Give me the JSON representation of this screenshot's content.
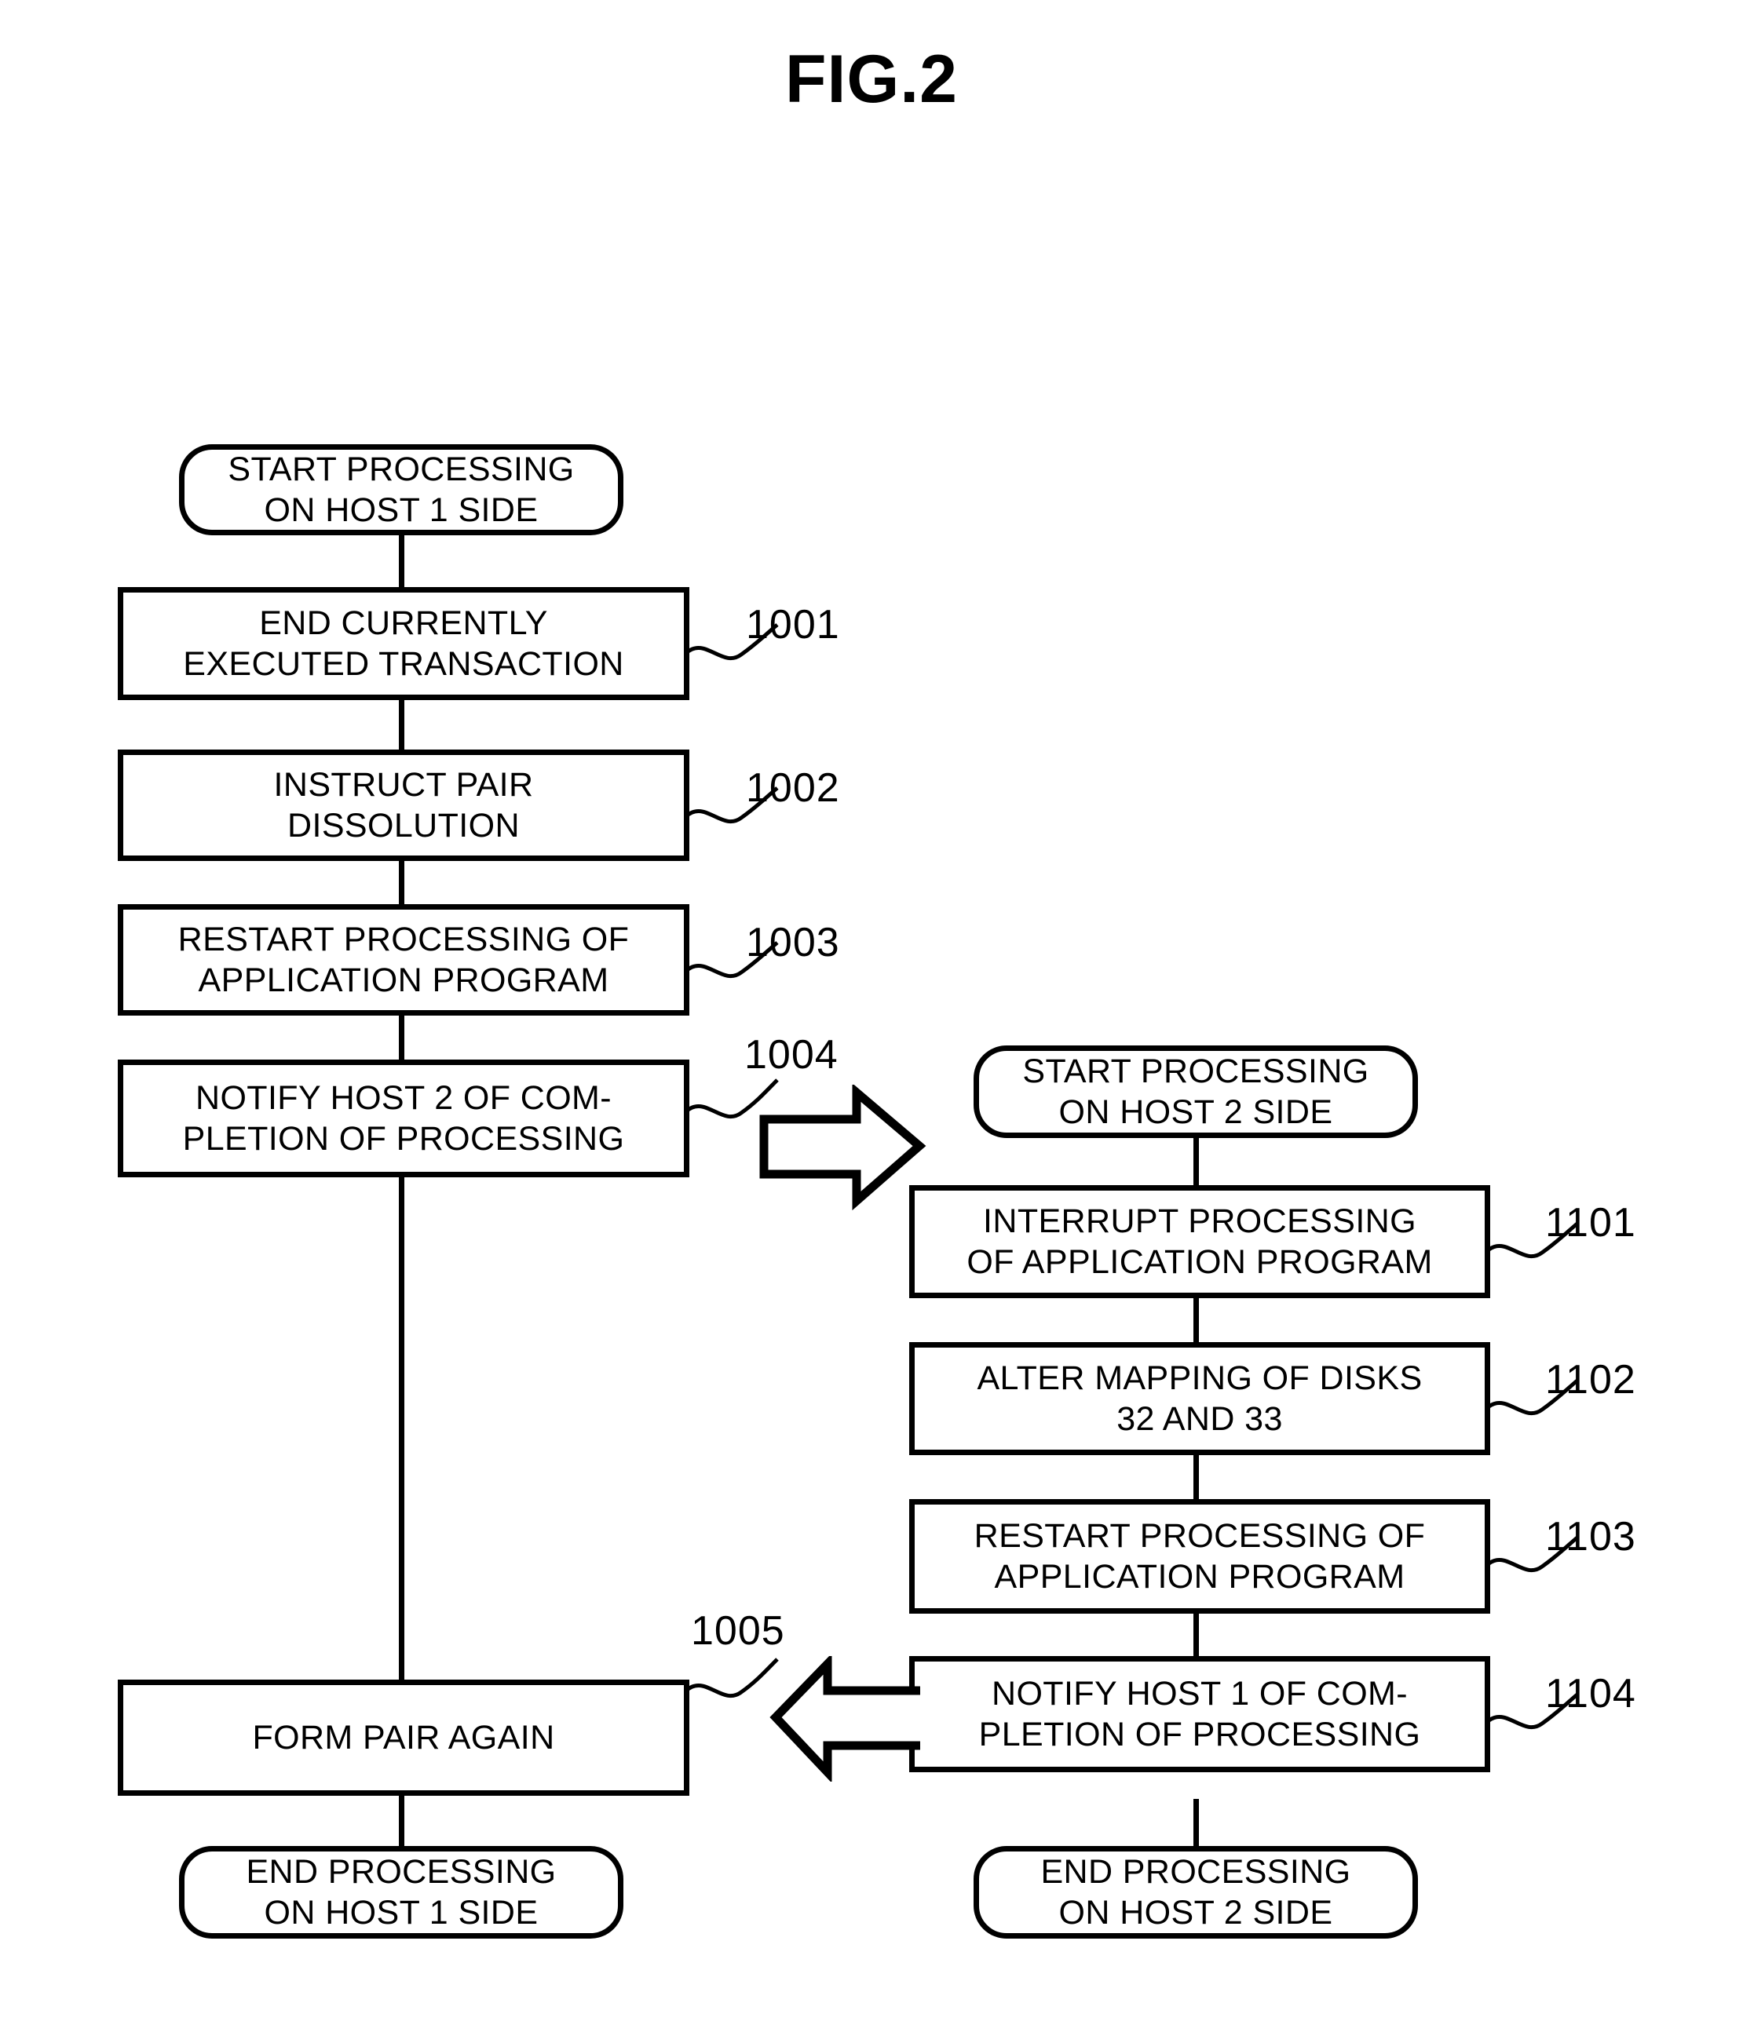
{
  "figure": {
    "title": "FIG.2",
    "type": "flowchart",
    "description": "Two-column process flowchart showing coordinated processing on Host 1 side and Host 2 side with cross-notification arrows."
  },
  "host1_column": {
    "start": {
      "label": "START PROCESSING\nON HOST 1 SIDE",
      "shape": "terminal"
    },
    "steps": [
      {
        "ref": "1001",
        "label": "END CURRENTLY\nEXECUTED TRANSACTION",
        "shape": "process"
      },
      {
        "ref": "1002",
        "label": "INSTRUCT PAIR\nDISSOLUTION",
        "shape": "process"
      },
      {
        "ref": "1003",
        "label": "RESTART PROCESSING OF\nAPPLICATION PROGRAM",
        "shape": "process"
      },
      {
        "ref": "1004",
        "label": "NOTIFY HOST 2 OF COM-\nPLETION OF PROCESSING",
        "shape": "process"
      },
      {
        "ref": "1005",
        "label": "FORM PAIR AGAIN",
        "shape": "process"
      }
    ],
    "end": {
      "label": "END PROCESSING\nON HOST 1 SIDE",
      "shape": "terminal"
    }
  },
  "host2_column": {
    "start": {
      "label": "START PROCESSING\nON HOST 2 SIDE",
      "shape": "terminal"
    },
    "steps": [
      {
        "ref": "1101",
        "label": "INTERRUPT PROCESSING\nOF APPLICATION PROGRAM",
        "shape": "process"
      },
      {
        "ref": "1102",
        "label": "ALTER MAPPING OF DISKS\n32 AND 33",
        "shape": "process"
      },
      {
        "ref": "1103",
        "label": "RESTART PROCESSING OF\nAPPLICATION PROGRAM",
        "shape": "process"
      },
      {
        "ref": "1104",
        "label": "NOTIFY HOST 1 OF COM-\nPLETION OF PROCESSING",
        "shape": "process"
      }
    ],
    "end": {
      "label": "END PROCESSING\nON HOST 2 SIDE",
      "shape": "terminal"
    }
  },
  "cross_arrows": [
    {
      "name": "host1-to-host2-arrow",
      "direction": "right",
      "from_ref": "1004",
      "to": "START PROCESSING ON HOST 2 SIDE"
    },
    {
      "name": "host2-to-host1-arrow",
      "direction": "left",
      "from_ref": "1104",
      "to_ref": "1005"
    }
  ],
  "colors": {
    "ink": "#000000",
    "paper": "#ffffff"
  }
}
